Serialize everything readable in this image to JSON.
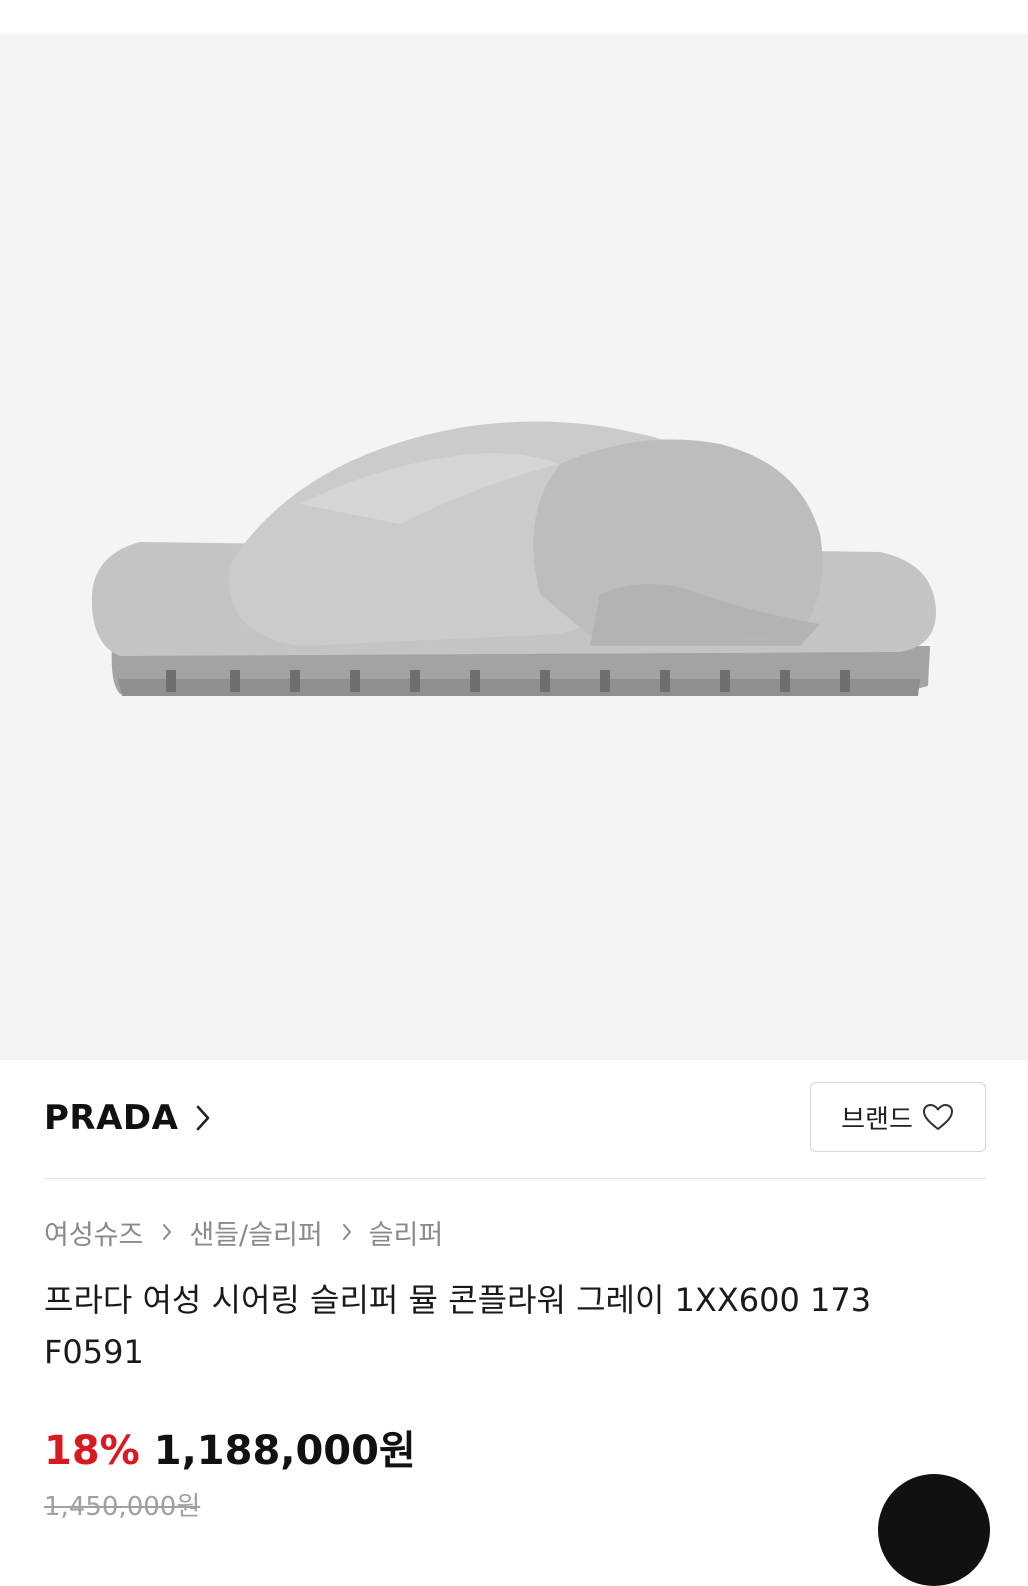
{
  "product_image": {
    "alt": "Gray shearling criss-cross slide slipper with lug sole",
    "colors": {
      "background": "#f4f4f4",
      "fur": "#c9c9c9",
      "fur_shadow": "#b4b4b4",
      "sole": "#9a9a9a"
    }
  },
  "brand": {
    "name": "PRADA",
    "chevron_icon": "chevron-right-icon",
    "button_label": "브랜드",
    "button_icon": "heart-outline-icon"
  },
  "breadcrumb": {
    "items": [
      "여성슈즈",
      "샌들/슬리퍼",
      "슬리퍼"
    ],
    "separator_icon": "chevron-right-icon"
  },
  "product": {
    "title": "프라다 여성 시어링 슬리퍼 뮬 콘플라워 그레이 1XX600 173 F0591"
  },
  "pricing": {
    "discount": "18%",
    "sale_price": "1,188,000원",
    "original_price": "1,450,000원",
    "discount_color": "#d71920"
  },
  "floating_action": {
    "icon": "chat-icon"
  }
}
